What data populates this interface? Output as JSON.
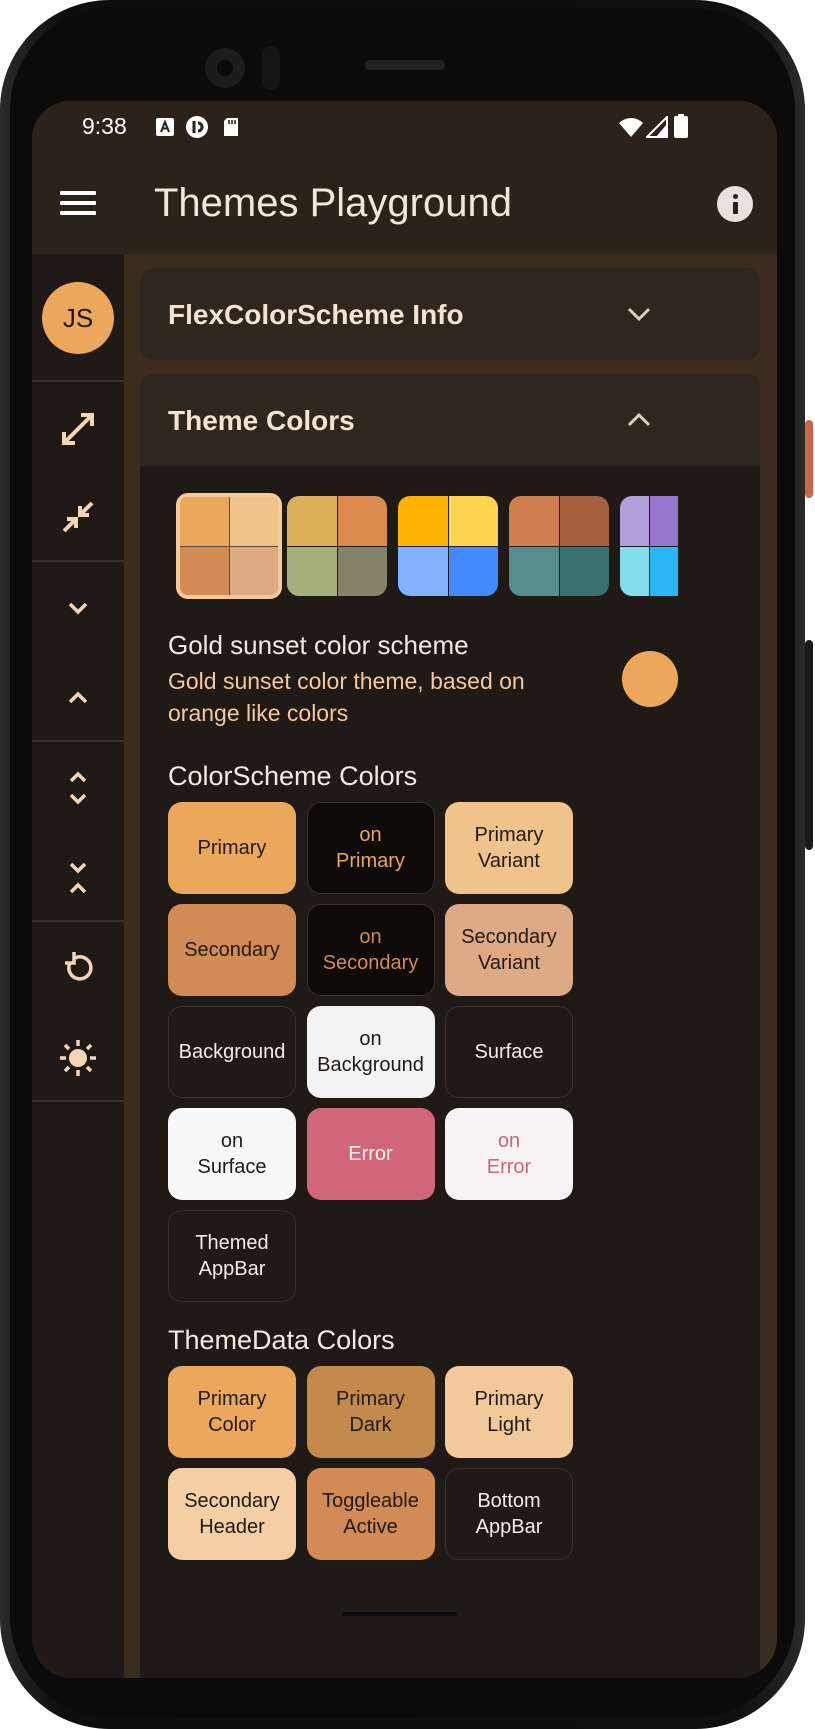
{
  "status_bar": {
    "time": "9:38"
  },
  "app_bar": {
    "title": "Themes Playground"
  },
  "rail": {
    "avatar_initials": "JS"
  },
  "cards": {
    "info_title": "FlexColorScheme Info",
    "colors_title": "Theme Colors"
  },
  "scheme": {
    "name": "Gold sunset color scheme",
    "description": "Gold sunset color theme, based on orange like colors",
    "color": "#eba85d"
  },
  "swatches": [
    {
      "colors": [
        "#eba85d",
        "#f0c28c",
        "#d28b54",
        "#deaa86"
      ],
      "selected": true
    },
    {
      "colors": [
        "#dcaf5a",
        "#da8a4e",
        "#a7b07a",
        "#858268"
      ],
      "selected": false
    },
    {
      "colors": [
        "#ffb300",
        "#ffd54f",
        "#82b1ff",
        "#448aff"
      ],
      "selected": false
    },
    {
      "colors": [
        "#cf7e50",
        "#a75f3d",
        "#568c8c",
        "#3b7070"
      ],
      "selected": false
    },
    {
      "colors": [
        "#b39ddb",
        "#9575cd",
        "#80deea",
        "#29b6f6"
      ],
      "selected": false
    }
  ],
  "colorscheme_section": {
    "title": "ColorScheme Colors",
    "tiles": [
      {
        "label": "Primary",
        "bg": "#eba85d",
        "fg": "#1f1a16"
      },
      {
        "label": "on\nPrimary",
        "bg": "#0d0a08",
        "fg": "#eba85d"
      },
      {
        "label": "Primary\nVariant",
        "bg": "#f0c28c",
        "fg": "#1f1a16"
      },
      {
        "label": "Secondary",
        "bg": "#d28b54",
        "fg": "#1f1a16"
      },
      {
        "label": "on\nSecondary",
        "bg": "#0d0a08",
        "fg": "#d28b54"
      },
      {
        "label": "Secondary\nVariant",
        "bg": "#deaa86",
        "fg": "#1f1a16"
      },
      {
        "label": "Background",
        "bg": "#1f1a16",
        "fg": "#f2ece6"
      },
      {
        "label": "on\nBackground",
        "bg": "#f3f3f3",
        "fg": "#1f1a16"
      },
      {
        "label": "Surface",
        "bg": "#1f1a16",
        "fg": "#f2ece6"
      },
      {
        "label": "on\nSurface",
        "bg": "#f8f8f8",
        "fg": "#1f1a16"
      },
      {
        "label": "Error",
        "bg": "#cf6679",
        "fg": "#f8eef0"
      },
      {
        "label": "on\nError",
        "bg": "#f8f4f6",
        "fg": "#cf6679"
      },
      {
        "label": "Themed\nAppBar",
        "bg": "#1f1a16",
        "fg": "#f2ece6"
      }
    ]
  },
  "themedata_section": {
    "title": "ThemeData Colors",
    "tiles": [
      {
        "label": "Primary\nColor",
        "bg": "#eba85d",
        "fg": "#1f1a16"
      },
      {
        "label": "Primary\nDark",
        "bg": "#c38a4c",
        "fg": "#1f1a16"
      },
      {
        "label": "Primary\nLight",
        "bg": "#f2c99a",
        "fg": "#1f1a16"
      },
      {
        "label": "Secondary\nHeader",
        "bg": "#f4cfa6",
        "fg": "#1f1a16"
      },
      {
        "label": "Toggleable\nActive",
        "bg": "#d28b54",
        "fg": "#1f1a16"
      },
      {
        "label": "Bottom\nAppBar",
        "bg": "#1f1a16",
        "fg": "#f2ece6"
      }
    ]
  }
}
